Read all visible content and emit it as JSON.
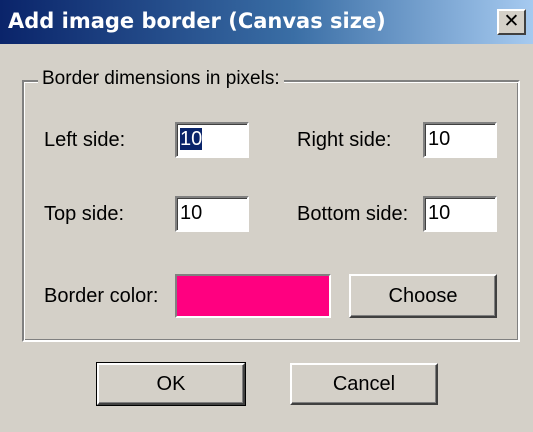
{
  "window": {
    "title": "Add image border (Canvas size)",
    "close_glyph": "✕"
  },
  "group": {
    "legend": "Border dimensions in pixels:"
  },
  "fields": {
    "left": {
      "label": "Left side:",
      "value": "10",
      "selected": true
    },
    "right": {
      "label": "Right side:",
      "value": "10"
    },
    "top": {
      "label": "Top side:",
      "value": "10"
    },
    "bottom": {
      "label": "Bottom side:",
      "value": "10"
    }
  },
  "border_color": {
    "label": "Border color:",
    "color": "#ff0080",
    "choose_label": "Choose"
  },
  "buttons": {
    "ok": "OK",
    "cancel": "Cancel"
  },
  "theme": {
    "face": "#d4d0c8",
    "title_start": "#0a246a",
    "title_end": "#a6caf0"
  }
}
